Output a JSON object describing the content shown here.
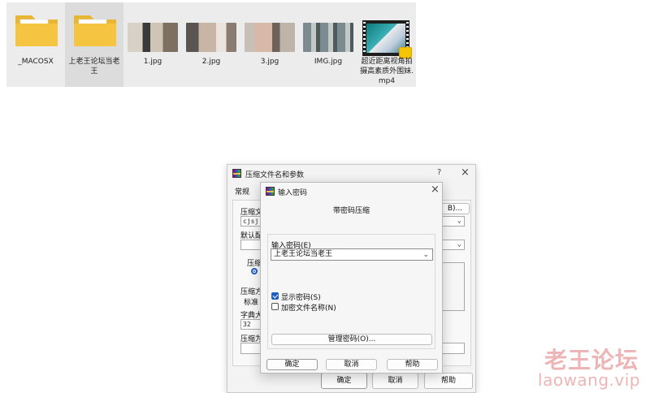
{
  "files": [
    {
      "name": "_MACOSX",
      "type": "folder",
      "state": "hover"
    },
    {
      "name": "上老王论坛当老王",
      "type": "folder",
      "state": "selected"
    },
    {
      "name": "1.jpg",
      "type": "image"
    },
    {
      "name": "2.jpg",
      "type": "image"
    },
    {
      "name": "3.jpg",
      "type": "image"
    },
    {
      "name": "IMG.jpg",
      "type": "image"
    },
    {
      "name": "超近距离视角拍摄高素质外围妹.mp4",
      "type": "video"
    }
  ],
  "outer_dialog": {
    "title": "压缩文件名和参数",
    "help_glyph": "?",
    "close_glyph": "×",
    "tab_general": "常规",
    "archive_name_label": "压缩文",
    "archive_name_value": "cjsj.r",
    "browse_button": "B)...",
    "default_profile_label": "默认配",
    "format_label": "压缩",
    "method_label": "压缩方",
    "method_value": "标准",
    "dict_label": "字典大",
    "dict_value": "32",
    "split_label": "压缩为",
    "ok_button": "确定",
    "cancel_button": "取消",
    "help_button": "帮助"
  },
  "inner_dialog": {
    "title": "输入密码",
    "close_glyph": "×",
    "heading": "带密码压缩",
    "password_label": "输入密码(E)",
    "password_value": "上老王论坛当老王",
    "show_password_label": "显示密码(S)",
    "show_password_checked": true,
    "encrypt_names_label": "加密文件名称(N)",
    "encrypt_names_checked": false,
    "manage_button": "管理密码(O)...",
    "ok_button": "确定",
    "cancel_button": "取消",
    "help_button": "帮助"
  },
  "watermark": {
    "cn": "老王论坛",
    "en": "laowang.vip"
  },
  "colors": {
    "accent": "#1f5fbf",
    "folder": "#f5c542",
    "watermark": "#de7878"
  },
  "icons": {
    "folder": "folder-icon",
    "archive_app": "winrar-icon",
    "dropdown": "chevron-down-icon",
    "close": "close-icon",
    "help": "help-icon"
  }
}
